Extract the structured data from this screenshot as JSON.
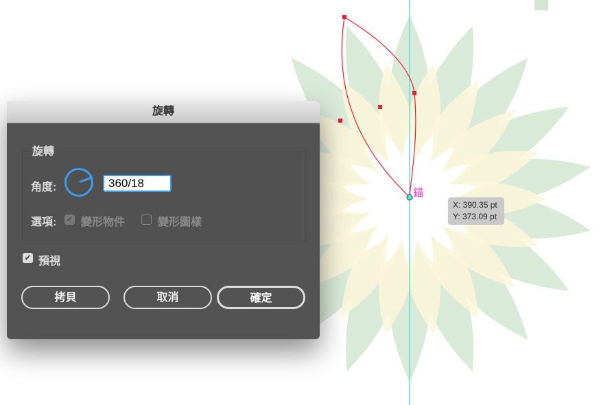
{
  "dialog": {
    "title": "旋轉",
    "group_label": "旋轉",
    "angle_label": "角度:",
    "angle_value": "360/18",
    "options_label": "選項:",
    "opt_transform_objects": "變形物件",
    "opt_transform_objects_checked": true,
    "opt_transform_patterns": "變形圖樣",
    "opt_transform_patterns_checked": false,
    "preview_label": "預視",
    "preview_checked": true,
    "copy_button": "拷貝",
    "cancel_button": "取消",
    "ok_button": "確定"
  },
  "canvas": {
    "anchor_label": "錨",
    "x_readout": "X: 390.35 pt",
    "y_readout": "Y: 373.09 pt",
    "petal_count": 18,
    "colors": {
      "petal_green": "#d3e6d2",
      "petal_yellow": "#fcf6d9",
      "path": "#e8202f",
      "guide": "#4fe3e0",
      "accent": "#3d9cf0"
    }
  }
}
